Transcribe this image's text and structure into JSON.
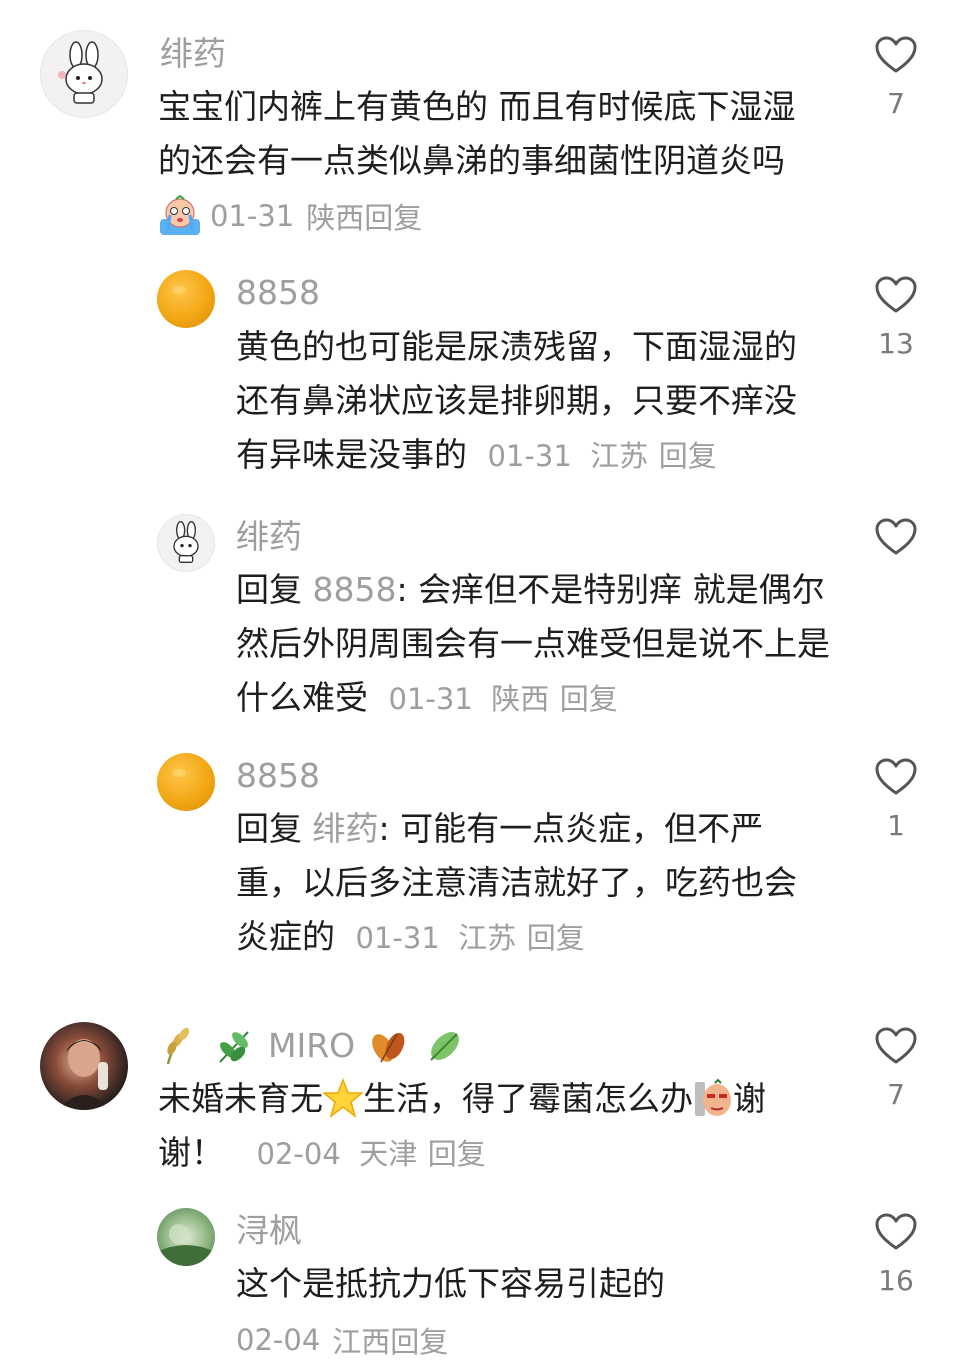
{
  "comments": [
    {
      "username": "绯药",
      "text": "宝宝们内裤上有黄色的 而且有时候底下湿湿的还会有一点类似鼻涕的事细菌性阴道炎吗",
      "date": "01-31",
      "location": "陕西",
      "reply_label": "回复",
      "likes": "7",
      "avatar": "bunny-avatar"
    },
    {
      "username": "8858",
      "text": "黄色的也可能是尿渍残留，下面湿湿的还有鼻涕状应该是排卵期，只要不痒没有异味是没事的",
      "date": "01-31",
      "location": "江苏",
      "reply_label": "回复",
      "likes": "13",
      "avatar": "orange-avatar"
    },
    {
      "username": "绯药",
      "reply_prefix": "回复",
      "reply_to": "8858",
      "text": ": 会痒但不是特别痒 就是偶尔 然后外阴周围会有一点难受但是说不上是什么难受",
      "date": "01-31",
      "location": "陕西",
      "reply_label": "回复",
      "likes": "",
      "avatar": "bunny-avatar"
    },
    {
      "username": "8858",
      "reply_prefix": "回复",
      "reply_to": "绯药",
      "text": ": 可能有一点炎症，但不严重，以后多注意清洁就好了，吃药也会炎症的",
      "date": "01-31",
      "location": "江苏",
      "reply_label": "回复",
      "likes": "1",
      "avatar": "orange-avatar"
    },
    {
      "username": "MIRO",
      "text_before": "未婚未育无",
      "text_middle": "生活，得了霉菌怎么办",
      "text_after": "谢谢！",
      "date": "02-04",
      "location": "天津",
      "reply_label": "回复",
      "likes": "7",
      "avatar": "photo-avatar"
    },
    {
      "username": "浔枫",
      "text": "这个是抵抗力低下容易引起的",
      "date": "02-04",
      "location": "江西",
      "reply_label": "回复",
      "likes": "16",
      "avatar": "nature-avatar"
    }
  ]
}
